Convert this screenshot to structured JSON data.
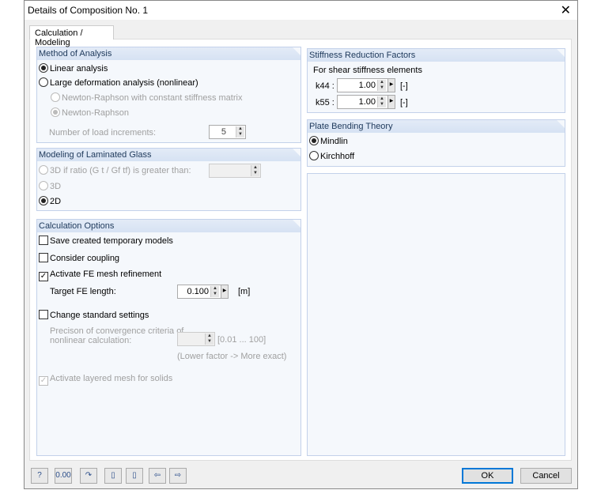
{
  "window": {
    "title": "Details of Composition No. 1",
    "close": "✕"
  },
  "tab": "Calculation / Modeling",
  "method": {
    "title": "Method of Analysis",
    "linear": "Linear analysis",
    "large": "Large deformation analysis (nonlinear)",
    "nr_const": "Newton-Raphson with constant stiffness matrix",
    "nr": "Newton-Raphson",
    "increments_label": "Number of load increments:",
    "increments": "5",
    "selected": "linear"
  },
  "laminated": {
    "title": "Modeling of Laminated Glass",
    "opt3d_ratio": "3D if ratio (G t / Gf tf) is greater than:",
    "opt3d": "3D",
    "opt2d": "2D",
    "ratio_value": "",
    "selected": "2D"
  },
  "calc": {
    "title": "Calculation Options",
    "save_models": "Save created temporary models",
    "coupling": "Consider coupling",
    "mesh_refine": "Activate FE mesh refinement",
    "target_label": "Target FE length:",
    "target_value": "0.100",
    "target_unit": "[m]",
    "change_std": "Change standard settings",
    "precision_label1": "Precison of convergence criteria of",
    "precision_label2": "nonlinear calculation:",
    "precision_range": "[0.01 ... 100]",
    "precision_hint": "(Lower factor -> More exact)",
    "layered": "Activate layered mesh for solids",
    "states": {
      "save_models": false,
      "coupling": false,
      "mesh_refine": true,
      "change_std": false,
      "layered": true
    }
  },
  "stiffness": {
    "title": "Stiffness Reduction Factors",
    "subtitle": "For shear stiffness elements",
    "k44_label": "k44 :",
    "k44": "1.00",
    "k55_label": "k55 :",
    "k55": "1.00",
    "unit": "[-]"
  },
  "plate": {
    "title": "Plate Bending Theory",
    "mindlin": "Mindlin",
    "kirchhoff": "Kirchhoff",
    "selected": "Mindlin"
  },
  "footer": {
    "ok": "OK",
    "cancel": "Cancel",
    "tools": [
      "help-icon",
      "units-icon",
      "reset-icon",
      "copy-icon",
      "paste-icon",
      "import-icon",
      "export-icon"
    ],
    "units_text": "0.00"
  }
}
